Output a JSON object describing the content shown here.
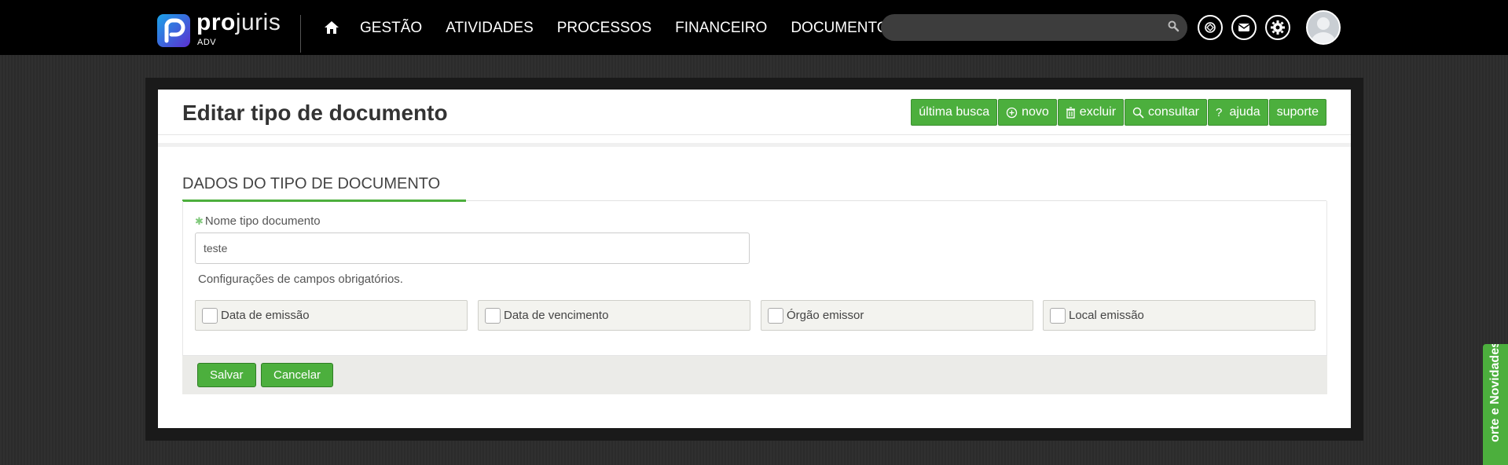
{
  "topbar": {
    "brand_bold": "pro",
    "brand_light": "juris",
    "brand_sub": "ADV",
    "nav": [
      "GESTÃO",
      "ATIVIDADES",
      "PROCESSOS",
      "FINANCEIRO",
      "DOCUMENTOS"
    ],
    "search_value": "",
    "icons": [
      "home-icon",
      "search-icon",
      "chat-icon",
      "mail-icon",
      "settings-icon",
      "avatar"
    ]
  },
  "page": {
    "title": "Editar tipo de documento",
    "toolbar": [
      "última busca",
      "novo",
      "excluir",
      "consultar",
      "ajuda",
      "suporte"
    ],
    "section_title": "DADOS DO TIPO DE DOCUMENTO",
    "name_label": "Nome tipo documento",
    "name_value": "teste",
    "config_text": "Configurações de campos obrigatórios.",
    "checkboxes": [
      {
        "label": "Data de emissão",
        "checked": false
      },
      {
        "label": "Data de vencimento",
        "checked": false
      },
      {
        "label": "Órgão emissor",
        "checked": false
      },
      {
        "label": "Local emissão",
        "checked": false
      }
    ],
    "save_label": "Salvar",
    "cancel_label": "Cancelar"
  },
  "side_tab": "orte e Novidades",
  "colors": {
    "accent": "#4caf3d",
    "topbar": "#000000",
    "background": "#2b2b2b"
  }
}
